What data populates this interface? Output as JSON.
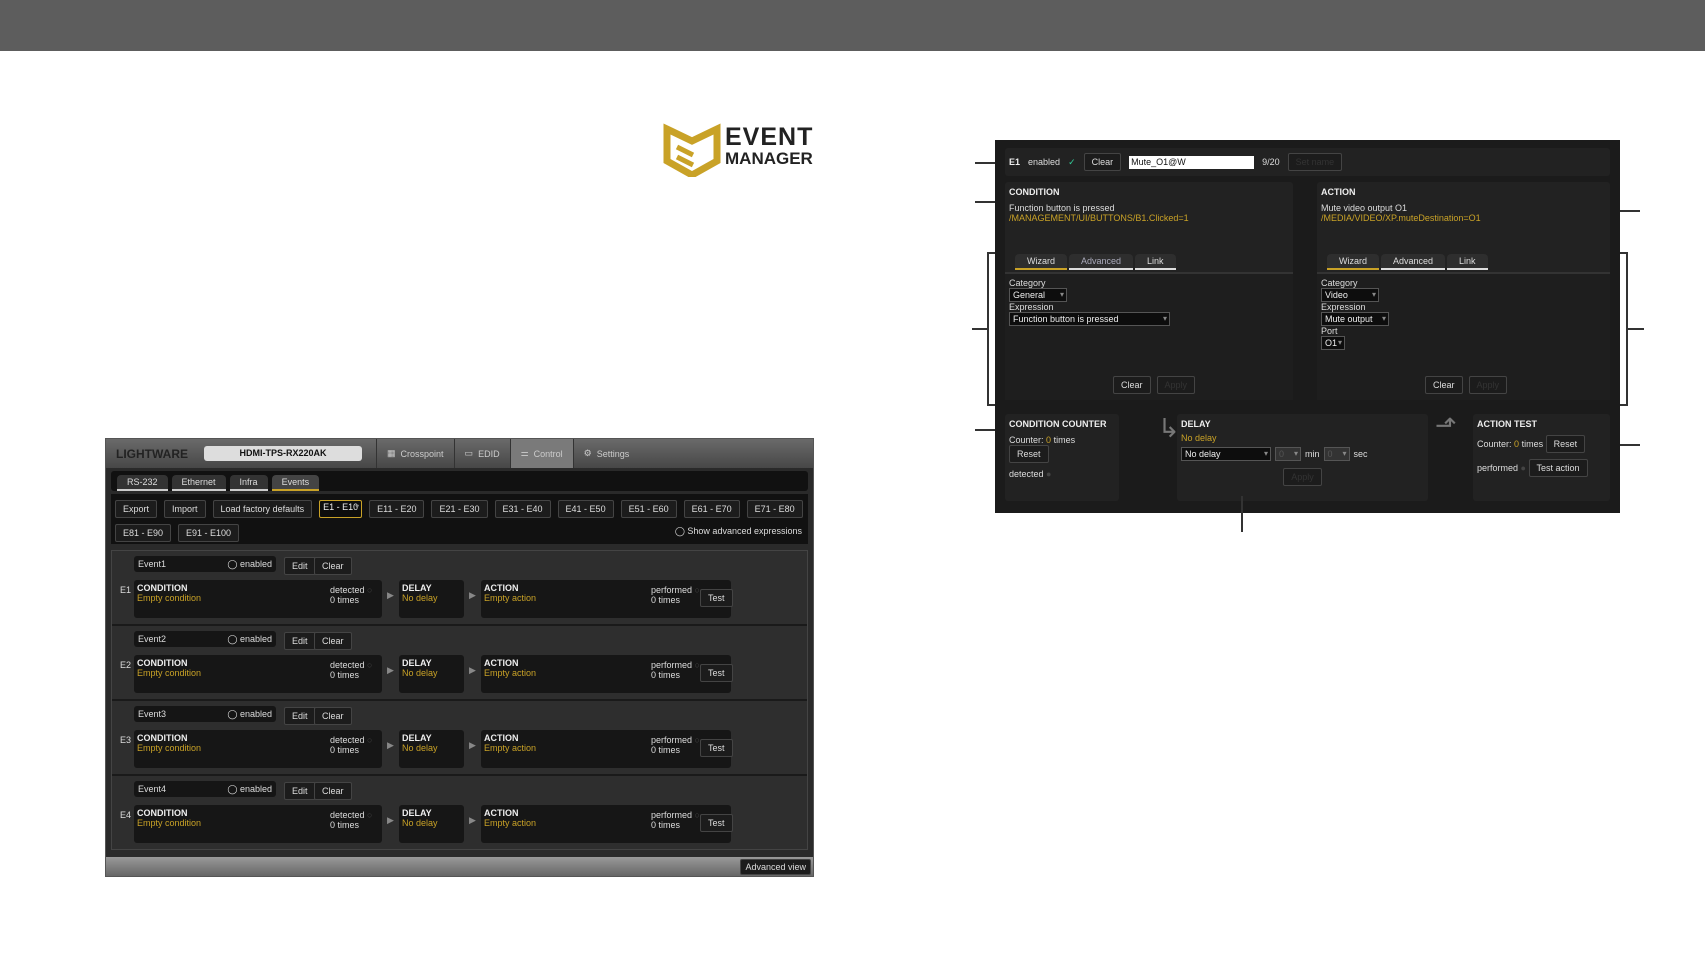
{
  "logo": {
    "line1": "EVENT",
    "line2": "MANAGER",
    "color": "#c9a227"
  },
  "app": {
    "brand": "LIGHTWARE",
    "device": "HDMI-TPS-RX220AK",
    "main_tabs": [
      {
        "label": "Crosspoint",
        "icon": "grid-icon"
      },
      {
        "label": "EDID",
        "icon": "monitor-icon"
      },
      {
        "label": "Control",
        "icon": "control-icon"
      },
      {
        "label": "Settings",
        "icon": "gear-icon"
      }
    ],
    "sub_tabs": [
      "RS-232",
      "Ethernet",
      "Infra",
      "Events"
    ],
    "toolbar": [
      "Export",
      "Import",
      "Load factory defaults"
    ],
    "ranges": [
      "E1 - E10",
      "E11 - E20",
      "E21 - E30",
      "E31 - E40",
      "E41 - E50",
      "E51 - E60",
      "E61 - E70",
      "E71 - E80",
      "E81 - E90",
      "E91 - E100"
    ],
    "show_advanced": "Show advanced expressions",
    "events": [
      {
        "id": "E1",
        "name": "Event1"
      },
      {
        "id": "E2",
        "name": "Event2"
      },
      {
        "id": "E3",
        "name": "Event3"
      },
      {
        "id": "E4",
        "name": "Event4"
      }
    ],
    "labels": {
      "enabled": "enabled",
      "edit": "Edit",
      "clear": "Clear",
      "condition": "CONDITION",
      "empty_condition": "Empty condition",
      "detected": "detected",
      "times": "0 times",
      "delay": "DELAY",
      "no_delay": "No delay",
      "action": "ACTION",
      "empty_action": "Empty action",
      "performed": "performed",
      "test": "Test"
    },
    "advanced_view": "Advanced view"
  },
  "detail": {
    "id": "E1",
    "enabled": "enabled",
    "clear": "Clear",
    "name_value": "Mute_O1@W",
    "name_count": "9/20",
    "set_name": "Set name",
    "condition": {
      "title": "CONDITION",
      "desc": "Function button is pressed",
      "path": "/MANAGEMENT/UI/BUTTONS/B1.Clicked=1",
      "tabs": [
        "Wizard",
        "Advanced",
        "Link"
      ],
      "category_label": "Category",
      "category": "General",
      "expression_label": "Expression",
      "expression": "Function button is pressed",
      "clear": "Clear",
      "apply": "Apply"
    },
    "action": {
      "title": "ACTION",
      "desc": "Mute video output O1",
      "path": "/MEDIA/VIDEO/XP.muteDestination=O1",
      "tabs": [
        "Wizard",
        "Advanced",
        "Link"
      ],
      "category_label": "Category",
      "category": "Video",
      "expression_label": "Expression",
      "expression": "Mute output",
      "port_label": "Port",
      "port": "O1",
      "clear": "Clear",
      "apply": "Apply"
    },
    "counter": {
      "title": "CONDITION COUNTER",
      "counter": "Counter:",
      "value": "0",
      "times": "times",
      "reset": "Reset",
      "detected": "detected"
    },
    "delay": {
      "title": "DELAY",
      "status": "No delay",
      "select": "No delay",
      "min_value": "0",
      "min": "min",
      "sec_value": "0",
      "sec": "sec",
      "apply": "Apply"
    },
    "test": {
      "title": "ACTION TEST",
      "counter": "Counter:",
      "value": "0",
      "times": "times",
      "reset": "Reset",
      "performed": "performed",
      "test_action": "Test action"
    }
  }
}
